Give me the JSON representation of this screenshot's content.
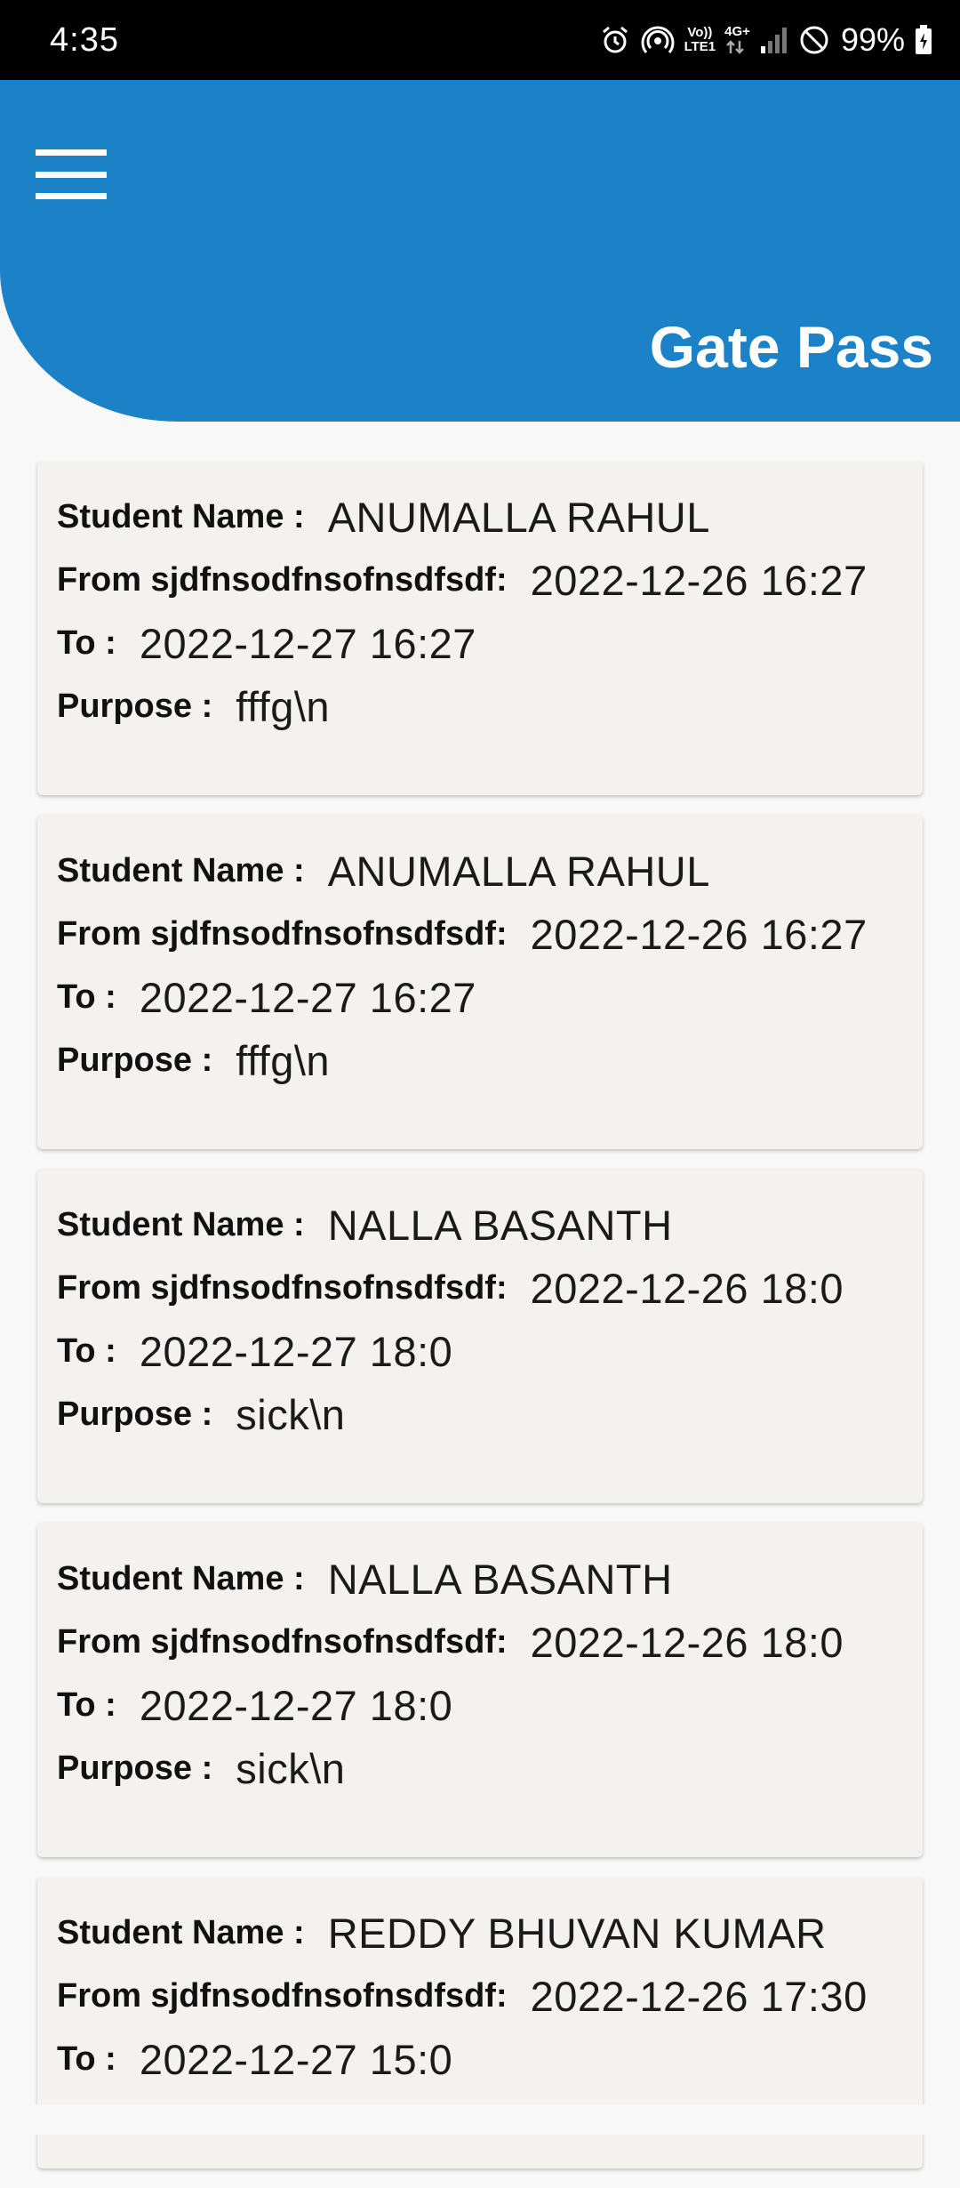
{
  "status_bar": {
    "time": "4:35",
    "volte": "Vo))",
    "lte": "LTE1",
    "network": "4G+",
    "battery": "99%",
    "icons": [
      "alarm-icon",
      "hotspot-icon",
      "volte-icon",
      "4g-icon",
      "signal-icon",
      "dnd-icon",
      "battery-icon"
    ]
  },
  "header": {
    "title": "Gate Pass",
    "color": "#1c82c8",
    "menu_icon": "hamburger-menu-icon"
  },
  "labels": {
    "student_name": "Student Name :",
    "from": "From sjdfnsodfnsofnsdfsdf:",
    "to": "To :",
    "purpose": "Purpose :"
  },
  "passes": [
    {
      "student_name": "ANUMALLA RAHUL",
      "from": "2022-12-26 16:27",
      "to": "2022-12-27 16:27",
      "purpose": "fffg\\n"
    },
    {
      "student_name": "ANUMALLA RAHUL",
      "from": "2022-12-26 16:27",
      "to": "2022-12-27 16:27",
      "purpose": "fffg\\n"
    },
    {
      "student_name": "NALLA BASANTH",
      "from": "2022-12-26 18:0",
      "to": "2022-12-27 18:0",
      "purpose": "sick\\n"
    },
    {
      "student_name": "NALLA BASANTH",
      "from": "2022-12-26 18:0",
      "to": "2022-12-27 18:0",
      "purpose": "sick\\n"
    },
    {
      "student_name": "REDDY BHUVAN KUMAR",
      "from": "2022-12-26 17:30",
      "to": "2022-12-27 15:0"
    }
  ]
}
